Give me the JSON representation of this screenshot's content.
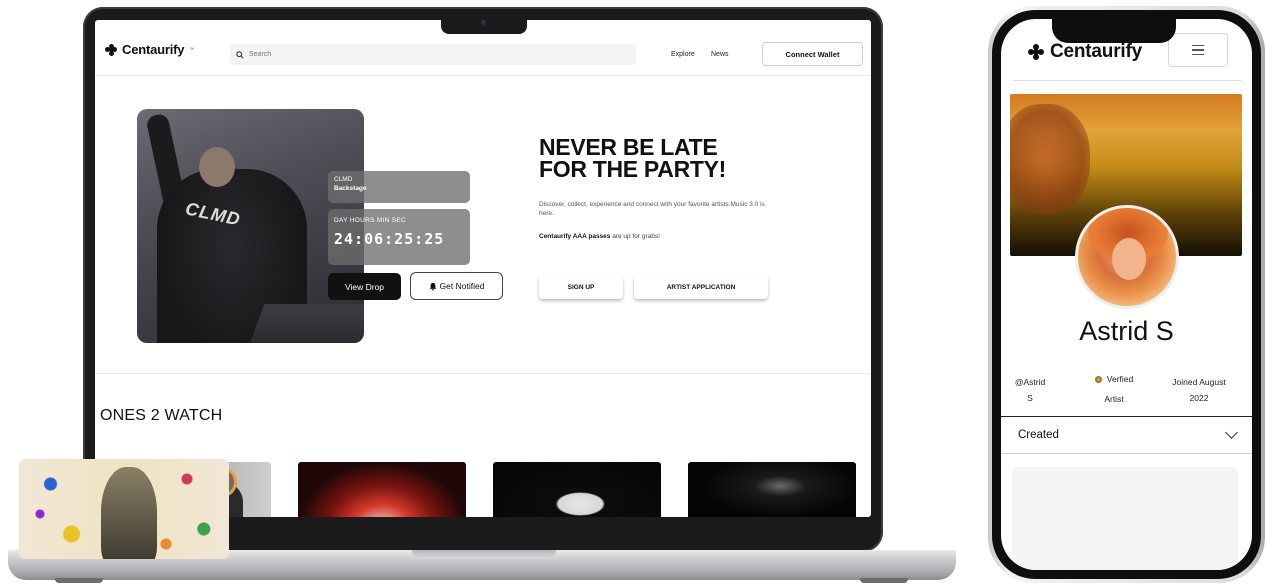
{
  "desktop": {
    "brand": "Centaurify",
    "brand_mark": "™",
    "search_placeholder": "Search",
    "nav_links": [
      "Explore",
      "News"
    ],
    "connect_wallet": "Connect Wallet",
    "drop": {
      "artist": "CLMD",
      "title": "Backstage",
      "timer_labels": "DAY HOURS MIN SEC",
      "timer_value": "24:06:25:25",
      "view_drop": "View Drop",
      "get_notified": "Get Notified"
    },
    "hero": {
      "headline_line1": "NEVER BE LATE",
      "headline_line2": "FOR THE PARTY!",
      "description": "Discover, collect, experience and connect with your favorite artists.Music 3.0 is here.",
      "passes_bold": "Centaurify AAA passes",
      "passes_rest": " are up for grabs!",
      "signup": "SIGN UP",
      "artist_application": "ARTIST APPLICATION"
    },
    "section_title": "ONES 2 WATCH"
  },
  "mobile": {
    "brand": "Centaurify",
    "artist_name": "Astrid S",
    "handle_line1": "@Astrid",
    "handle_line2": "S",
    "verified_line1": "Verfied",
    "verified_line2": "Artist",
    "joined_line1": "Joined August",
    "joined_line2": "2022",
    "dropdown_value": "Created"
  }
}
